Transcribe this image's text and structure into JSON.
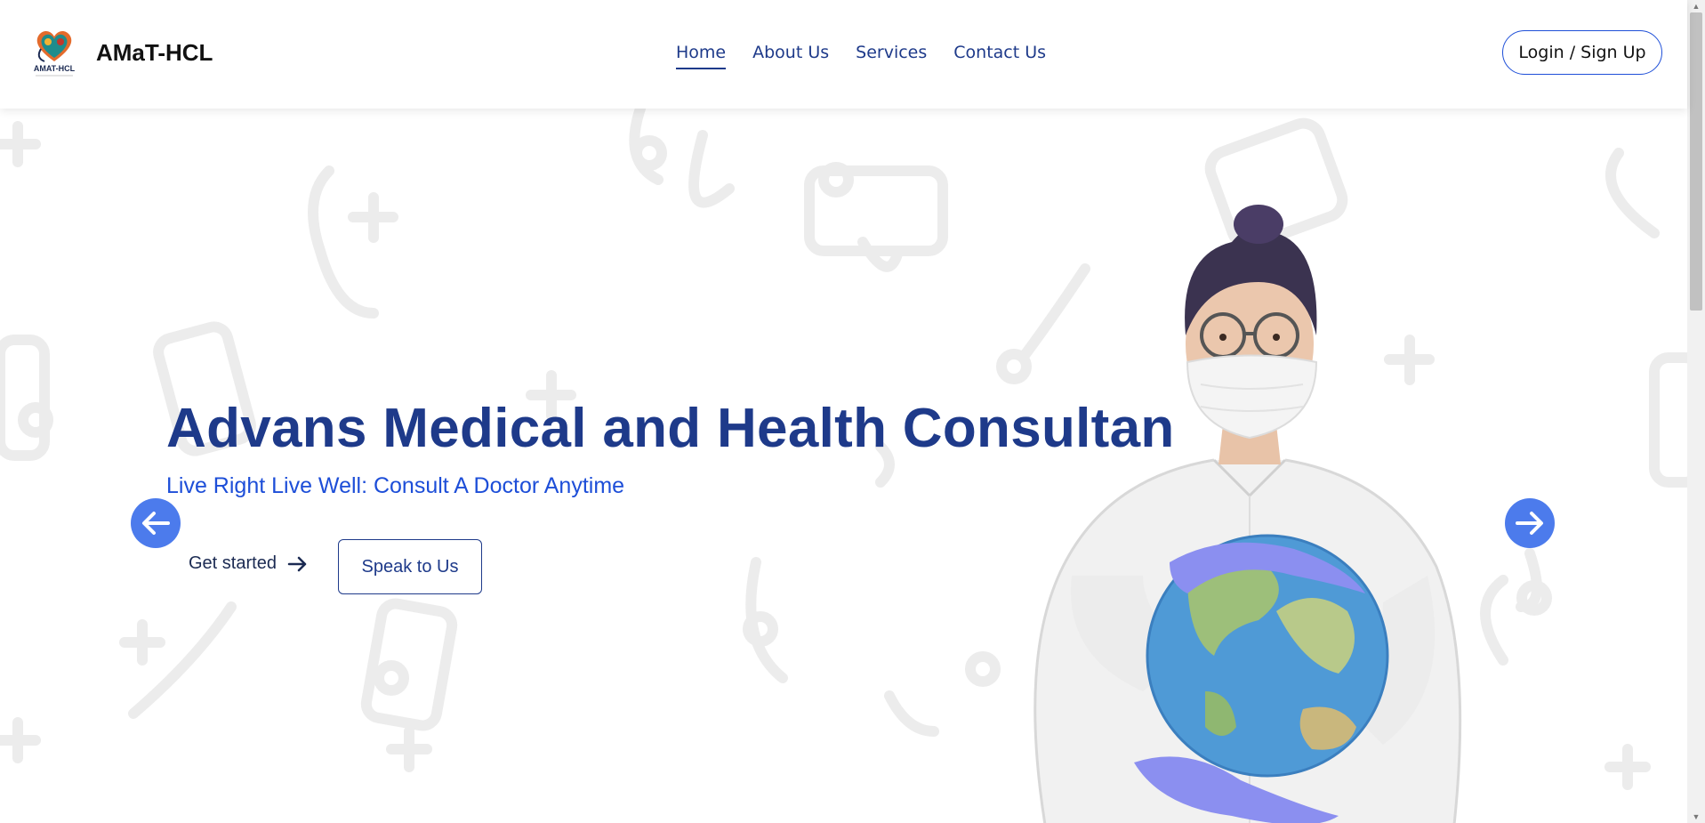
{
  "header": {
    "brand": "AMaT-HCL",
    "logo_text": "AMAT-HCL",
    "nav": [
      {
        "label": "Home",
        "active": true
      },
      {
        "label": "About Us",
        "active": false
      },
      {
        "label": "Services",
        "active": false
      },
      {
        "label": "Contact Us",
        "active": false
      }
    ],
    "login_label": "Login / Sign Up"
  },
  "hero": {
    "title": "Advans Medical and Health Consultan",
    "subtitle": "Live Right Live Well: Consult A Doctor Anytime",
    "get_started_label": "Get started",
    "speak_label": "Speak to Us",
    "prev_icon": "arrow-left-icon",
    "next_icon": "arrow-right-icon"
  },
  "colors": {
    "primary": "#1e3a8a",
    "accent": "#1d4ed8",
    "carousel_arrow": "#4c7bec"
  }
}
